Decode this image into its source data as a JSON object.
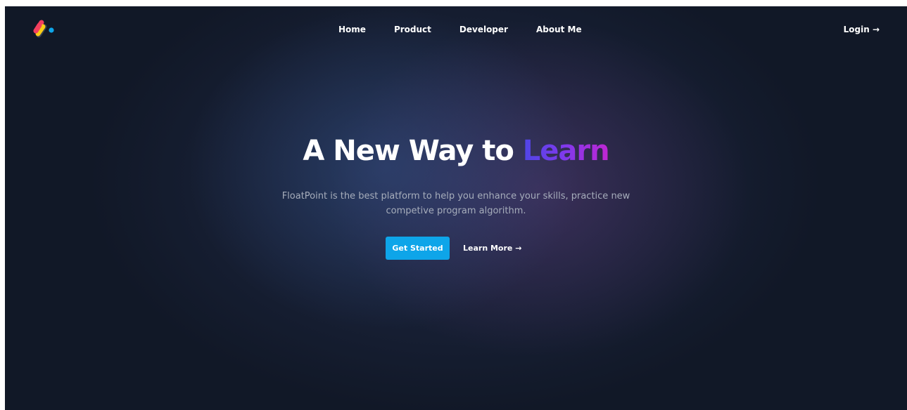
{
  "brand": {
    "logo_icon": "floatpoint-logo-icon",
    "colors": {
      "pink": "#f43f5e",
      "yellow": "#facc15",
      "blue": "#0ea5e9",
      "dark": "#374151"
    }
  },
  "nav": {
    "items": [
      {
        "label": "Home"
      },
      {
        "label": "Product"
      },
      {
        "label": "Developer"
      },
      {
        "label": "About Me"
      }
    ],
    "login_label": "Login →"
  },
  "hero": {
    "title_main": "A New Way to ",
    "title_accent": "Learn",
    "subtitle": "FloatPoint is the best platform to help you enhance your skills, practice new competive program algorithm.",
    "primary_button": "Get Started",
    "secondary_link": "Learn More →"
  },
  "theme": {
    "background": "#111827",
    "accent_button": "#0ea5e9",
    "gradient_start": "#4f46e5",
    "gradient_end": "#c026d3"
  }
}
